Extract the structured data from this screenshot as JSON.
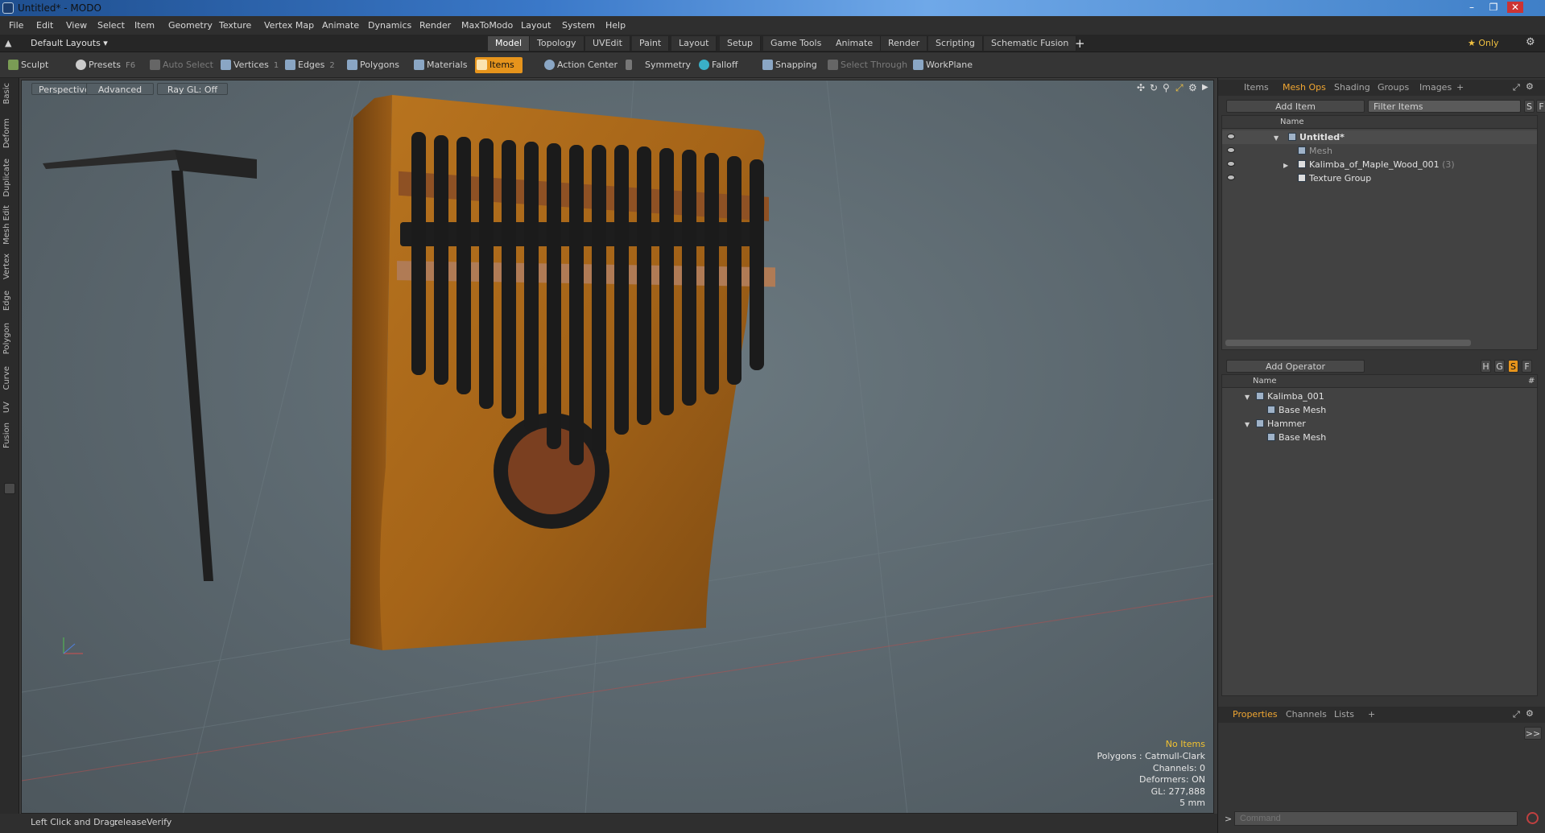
{
  "window": {
    "title": "Untitled* - MODO"
  },
  "menu": [
    "File",
    "Edit",
    "View",
    "Select",
    "Item",
    "Geometry",
    "Texture",
    "Vertex Map",
    "Animate",
    "Dynamics",
    "Render",
    "MaxToModo",
    "Layout",
    "System",
    "Help"
  ],
  "layout_bar": {
    "layout_selector": "Default Layouts ▾",
    "tabs": [
      "Model",
      "Topology",
      "UVEdit",
      "Paint",
      "Layout",
      "Setup",
      "Game Tools",
      "Animate",
      "Render",
      "Scripting",
      "Schematic Fusion"
    ],
    "active_tab": "Model",
    "add_tab": "+",
    "only_label": "★ Only"
  },
  "toolbar": {
    "sculpt": "Sculpt",
    "presets": "Presets",
    "presets_key": "F6",
    "auto_select": "Auto Select",
    "vertices": "Vertices",
    "vertices_key": "1",
    "edges": "Edges",
    "edges_key": "2",
    "polygons": "Polygons",
    "materials": "Materials",
    "items": "Items",
    "action_center": "Action Center",
    "symmetry": "Symmetry",
    "falloff": "Falloff",
    "snapping": "Snapping",
    "select_through": "Select Through",
    "workplane": "WorkPlane"
  },
  "left_tabs": [
    "Basic",
    "Deform",
    "Duplicate",
    "Mesh Edit",
    "Vertex",
    "Edge",
    "Polygon",
    "Curve",
    "UV",
    "Fusion"
  ],
  "viewport": {
    "view_mode": "Perspective",
    "shading": "Advanced",
    "raygl": "Ray GL: Off",
    "info": {
      "no_items": "No Items",
      "polygons": "Polygons : Catmull-Clark",
      "channels": "Channels: 0",
      "deformers": "Deformers: ON",
      "gl": "GL: 277,888",
      "unit": "5 mm"
    }
  },
  "status": {
    "hint_label": "Left Click and Drag:",
    "hint_value": "releaseVerify"
  },
  "items_panel": {
    "tabs": [
      "Items",
      "Mesh Ops",
      "Shading",
      "Groups",
      "Images",
      "+"
    ],
    "active_tab": "Mesh Ops",
    "add_item": "Add Item",
    "filter": "Filter Items",
    "s_btn": "S",
    "f_btn": "F",
    "col_name": "Name",
    "rows": [
      {
        "label": "Untitled*",
        "count": ""
      },
      {
        "label": "Mesh",
        "count": ""
      },
      {
        "label": "Kalimba_of_Maple_Wood_001",
        "count": "(3)"
      },
      {
        "label": "Texture Group",
        "count": ""
      }
    ]
  },
  "meshops_panel": {
    "add_operator": "Add Operator",
    "btn_h": "H",
    "btn_g": "G",
    "btn_s": "S",
    "btn_f": "F",
    "col_name": "Name",
    "col_hash": "#",
    "rows": [
      "Kalimba_001",
      "Base Mesh",
      "Hammer",
      "Base Mesh"
    ]
  },
  "properties_panel": {
    "tabs": [
      "Properties",
      "Channels",
      "Lists",
      "+"
    ],
    "active_tab": "Properties",
    "expand": ">>"
  },
  "command": {
    "placeholder": "Command"
  }
}
